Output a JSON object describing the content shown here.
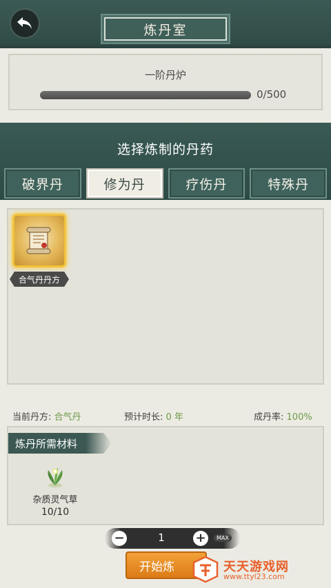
{
  "header": {
    "title": "炼丹室",
    "back_icon": "back-arrow-icon"
  },
  "furnace": {
    "name": "一阶丹炉",
    "progress_text": "0/500",
    "progress_fraction": 0
  },
  "select": {
    "title": "选择炼制的丹药"
  },
  "tabs": [
    {
      "label": "破界丹",
      "active": false
    },
    {
      "label": "修为丹",
      "active": true
    },
    {
      "label": "疗伤丹",
      "active": false
    },
    {
      "label": "特殊丹",
      "active": false
    }
  ],
  "recipes": [
    {
      "name": "合气丹丹方",
      "icon": "scroll-icon"
    }
  ],
  "info": {
    "current_label": "当前丹方:",
    "current_value": "合气丹",
    "duration_label": "预计时长:",
    "duration_value": "0 年",
    "rate_label": "成丹率:",
    "rate_value": "100%"
  },
  "materials": {
    "title": "炼丹所需材料",
    "items": [
      {
        "name": "杂质灵气草",
        "count": "10/10",
        "icon": "herb-icon"
      }
    ]
  },
  "stepper": {
    "minus": "−",
    "value": "1",
    "plus": "+",
    "max": "MAX"
  },
  "start_button": {
    "label": "开始炼"
  },
  "watermark": {
    "text": "天天游戏网",
    "url": "www.ttyl23.com"
  },
  "colors": {
    "accent_green": "#6c9a48",
    "teal": "#3b5853",
    "orange": "#dc7b16"
  }
}
